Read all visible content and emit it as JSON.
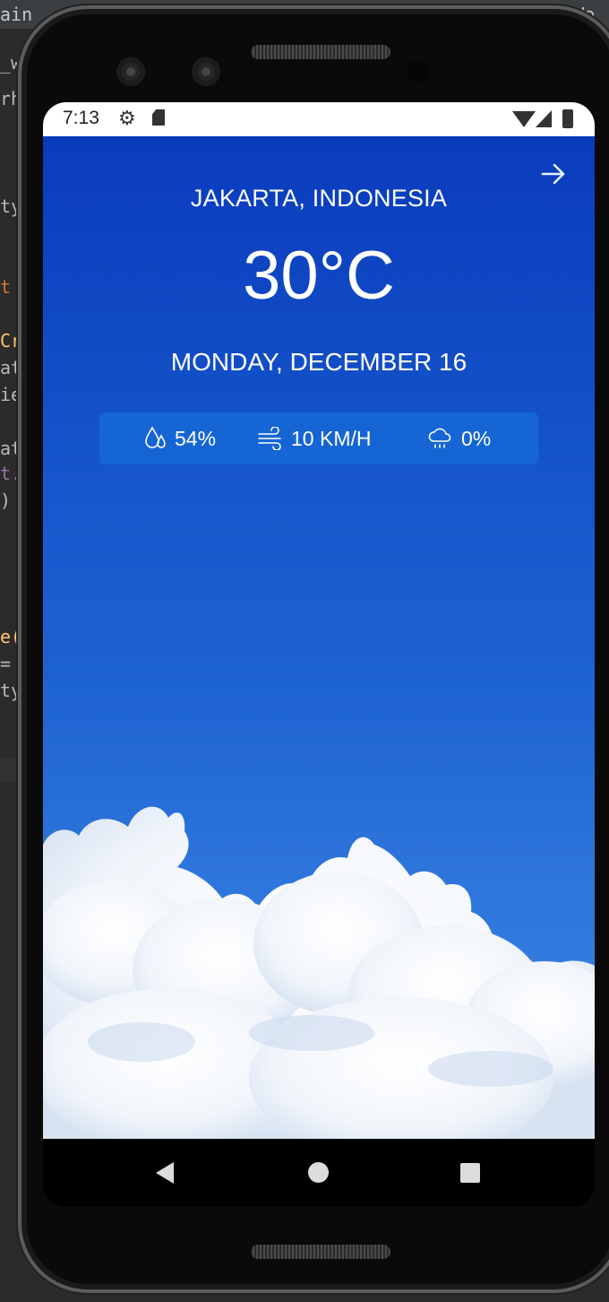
{
  "ide": {
    "tab_left": "ain",
    "tab_right": "We",
    "fragments": [
      "_w",
      "rh",
      "ty",
      "t",
      "Cr",
      "at",
      "ie",
      "at",
      "t.",
      ")",
      "e(",
      "=",
      "ty"
    ]
  },
  "status_bar": {
    "time": "7:13",
    "icons": [
      "gear-icon",
      "sd-card-icon",
      "wifi-icon",
      "signal-icon",
      "battery-icon"
    ]
  },
  "weather": {
    "location": "JAKARTA, INDONESIA",
    "temperature": "30°C",
    "date": "MONDAY, DECEMBER 16",
    "stats": {
      "humidity": "54%",
      "wind": "10 KM/H",
      "precipitation": "0%"
    },
    "next_icon": "arrow-right-icon"
  },
  "nav_bar": {
    "icons": [
      "back-icon",
      "home-icon",
      "recents-icon"
    ]
  },
  "colors": {
    "sky_top": "#0a3bbd",
    "sky_bottom": "#3e86e1",
    "stats_box": "#1668d6",
    "text": "#ffffff"
  }
}
